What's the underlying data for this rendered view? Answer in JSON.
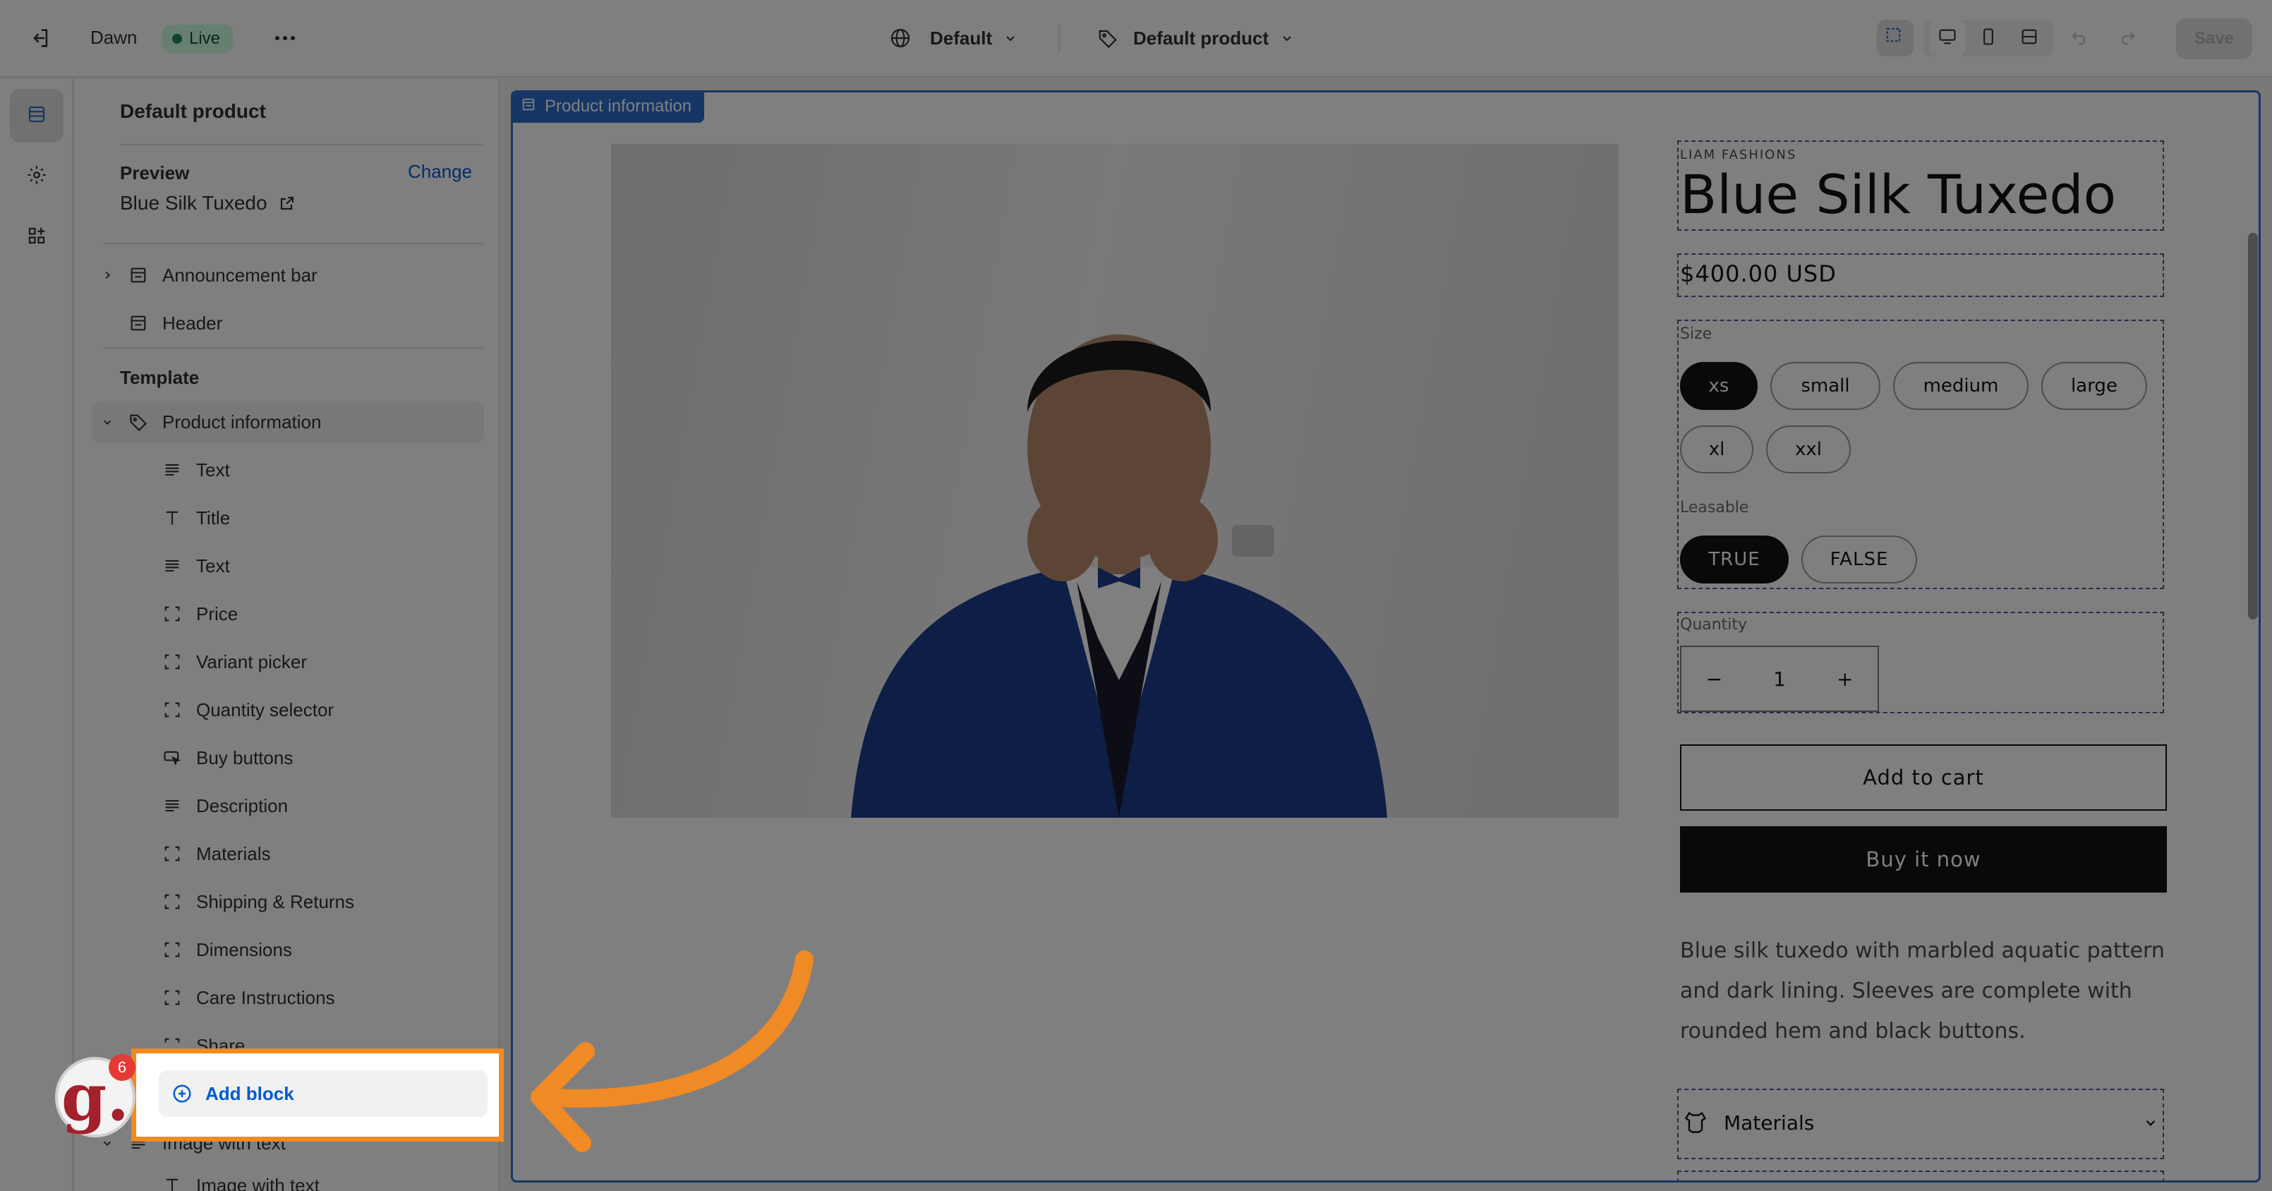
{
  "topbar": {
    "theme_name": "Dawn",
    "live_label": "Live",
    "more_icon": "ellipsis-icon",
    "language_selector": "Default",
    "template_selector": "Default product",
    "save_label": "Save"
  },
  "rail": {
    "items": [
      "sections-icon",
      "settings-gear-icon",
      "apps-icon"
    ]
  },
  "sidebar": {
    "title": "Default product",
    "preview_label": "Preview",
    "change_label": "Change",
    "preview_value": "Blue Silk Tuxedo",
    "header_sections": [
      {
        "label": "Announcement bar"
      },
      {
        "label": "Header"
      }
    ],
    "template_label": "Template",
    "product_section": "Product information",
    "blocks": [
      {
        "label": "Text",
        "icon": "text-lines-icon"
      },
      {
        "label": "Title",
        "icon": "title-t-icon"
      },
      {
        "label": "Text",
        "icon": "text-lines-icon"
      },
      {
        "label": "Price",
        "icon": "block-dashed-icon"
      },
      {
        "label": "Variant picker",
        "icon": "block-dashed-icon"
      },
      {
        "label": "Quantity selector",
        "icon": "block-dashed-icon"
      },
      {
        "label": "Buy buttons",
        "icon": "cursor-button-icon"
      },
      {
        "label": "Description",
        "icon": "text-lines-icon"
      },
      {
        "label": "Materials",
        "icon": "block-dashed-icon"
      },
      {
        "label": "Shipping & Returns",
        "icon": "block-dashed-icon"
      },
      {
        "label": "Dimensions",
        "icon": "block-dashed-icon"
      },
      {
        "label": "Care Instructions",
        "icon": "block-dashed-icon"
      },
      {
        "label": "Share",
        "icon": "block-dashed-icon"
      }
    ],
    "add_block": "Add block",
    "next_section": "Image with text",
    "next_section_block": "Image with text"
  },
  "preview": {
    "section_tag": "Product information",
    "vendor": "LIAM FASHIONS",
    "title": "Blue Silk Tuxedo",
    "price": "$400.00 USD",
    "size_label": "Size",
    "sizes": [
      "xs",
      "small",
      "medium",
      "large",
      "xl",
      "xxl"
    ],
    "selected_size": "xs",
    "leasable_label": "Leasable",
    "leasable_options": [
      "TRUE",
      "FALSE"
    ],
    "quantity_label": "Quantity",
    "quantity_minus": "−",
    "quantity_value": "1",
    "quantity_plus": "+",
    "add_to_cart": "Add to cart",
    "buy_now": "Buy it now",
    "description": "Blue silk tuxedo with marbled aquatic pattern and dark lining. Sleeves are complete with rounded hem and black buttons.",
    "materials_label": "Materials"
  },
  "tutorial": {
    "badge_letter": "g.",
    "badge_count": "6",
    "accent_color": "#f08a24"
  },
  "colors": {
    "editor_accent": "#2c6ecb",
    "link_blue": "#005bd3",
    "live_green": "#29845a"
  }
}
